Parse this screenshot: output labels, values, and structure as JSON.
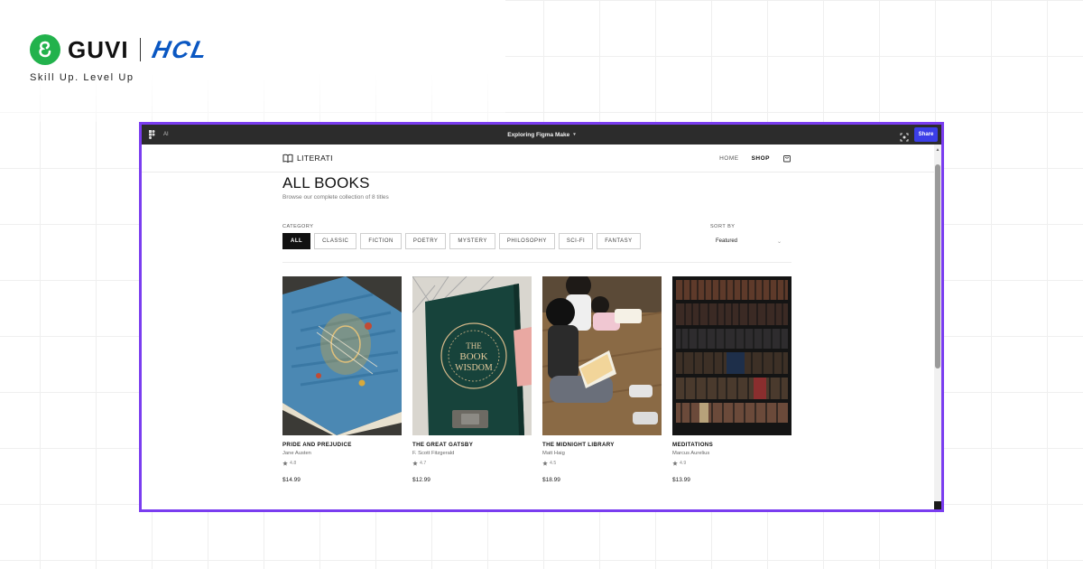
{
  "brand": {
    "guvi": "GUVI",
    "hcl": "HCL",
    "tagline": "Skill Up. Level Up"
  },
  "topbar": {
    "ai_label": "AI",
    "title": "Exploring Figma Make",
    "share_label": "Share"
  },
  "site": {
    "name": "LITERATI",
    "nav": [
      {
        "label": "HOME",
        "active": false
      },
      {
        "label": "SHOP",
        "active": true
      }
    ]
  },
  "page": {
    "title": "ALL BOOKS",
    "subtitle": "Browse our complete collection of 8 titles"
  },
  "filters": {
    "category_label": "CATEGORY",
    "categories": [
      {
        "label": "ALL",
        "active": true
      },
      {
        "label": "CLASSIC",
        "active": false
      },
      {
        "label": "FICTION",
        "active": false
      },
      {
        "label": "POETRY",
        "active": false
      },
      {
        "label": "MYSTERY",
        "active": false
      },
      {
        "label": "PHILOSOPHY",
        "active": false
      },
      {
        "label": "SCI-FI",
        "active": false
      },
      {
        "label": "FANTASY",
        "active": false
      }
    ],
    "sort_label": "SORT BY",
    "sort_value": "Featured"
  },
  "books": [
    {
      "title": "PRIDE AND PREJUDICE",
      "author": "Jane Austen",
      "rating": "4.8",
      "price": "$14.99",
      "cover_icon": "ornate-blue-book-image"
    },
    {
      "title": "THE GREAT GATSBY",
      "author": "F. Scott Fitzgerald",
      "rating": "4.7",
      "price": "$12.99",
      "cover_icon": "book-of-wisdom-image"
    },
    {
      "title": "THE MIDNIGHT LIBRARY",
      "author": "Matt Haig",
      "rating": "4.5",
      "price": "$18.99",
      "cover_icon": "children-reading-image"
    },
    {
      "title": "MEDITATIONS",
      "author": "Marcus Aurelius",
      "rating": "4.9",
      "price": "$13.99",
      "cover_icon": "bookshelf-image"
    }
  ],
  "colors": {
    "frame_border": "#7a3df0",
    "share_button": "#3b3ee8",
    "guvi_green": "#22b24c",
    "hcl_blue": "#0a57c2"
  }
}
